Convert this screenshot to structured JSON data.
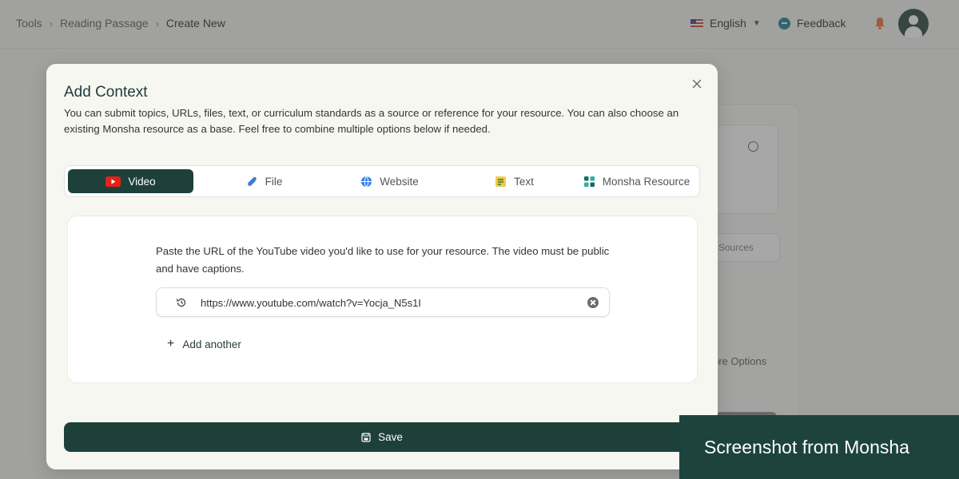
{
  "header": {
    "breadcrumb": [
      "Tools",
      "Reading Passage",
      "Create New"
    ],
    "language": "English",
    "feedback_label": "Feedback"
  },
  "background": {
    "sources_label": "Sources",
    "more_options_label": "ore Options"
  },
  "modal": {
    "title": "Add Context",
    "description": "You can submit topics, URLs, files, text, or curriculum standards as a source or reference for your resource. You can also choose an existing Monsha resource as a base. Feel free to combine multiple options below if needed.",
    "tabs": [
      {
        "label": "Video",
        "icon": "youtube-icon",
        "active": true
      },
      {
        "label": "File",
        "icon": "paperclip-icon",
        "active": false
      },
      {
        "label": "Website",
        "icon": "globe-icon",
        "active": false
      },
      {
        "label": "Text",
        "icon": "text-icon",
        "active": false
      },
      {
        "label": "Monsha Resource",
        "icon": "grid-icon",
        "active": false
      }
    ],
    "video": {
      "instructions": "Paste the URL of the YouTube video you'd like to use for your resource. The video must be public and have captions.",
      "url_value": "https://www.youtube.com/watch?v=Yocja_N5s1I",
      "add_another_label": "Add another"
    },
    "save_label": "Save"
  },
  "watermark": "Screenshot from Monsha",
  "colors": {
    "primary": "#1d403b",
    "youtube_red": "#e62117",
    "accent_teal": "#0e7c86"
  }
}
